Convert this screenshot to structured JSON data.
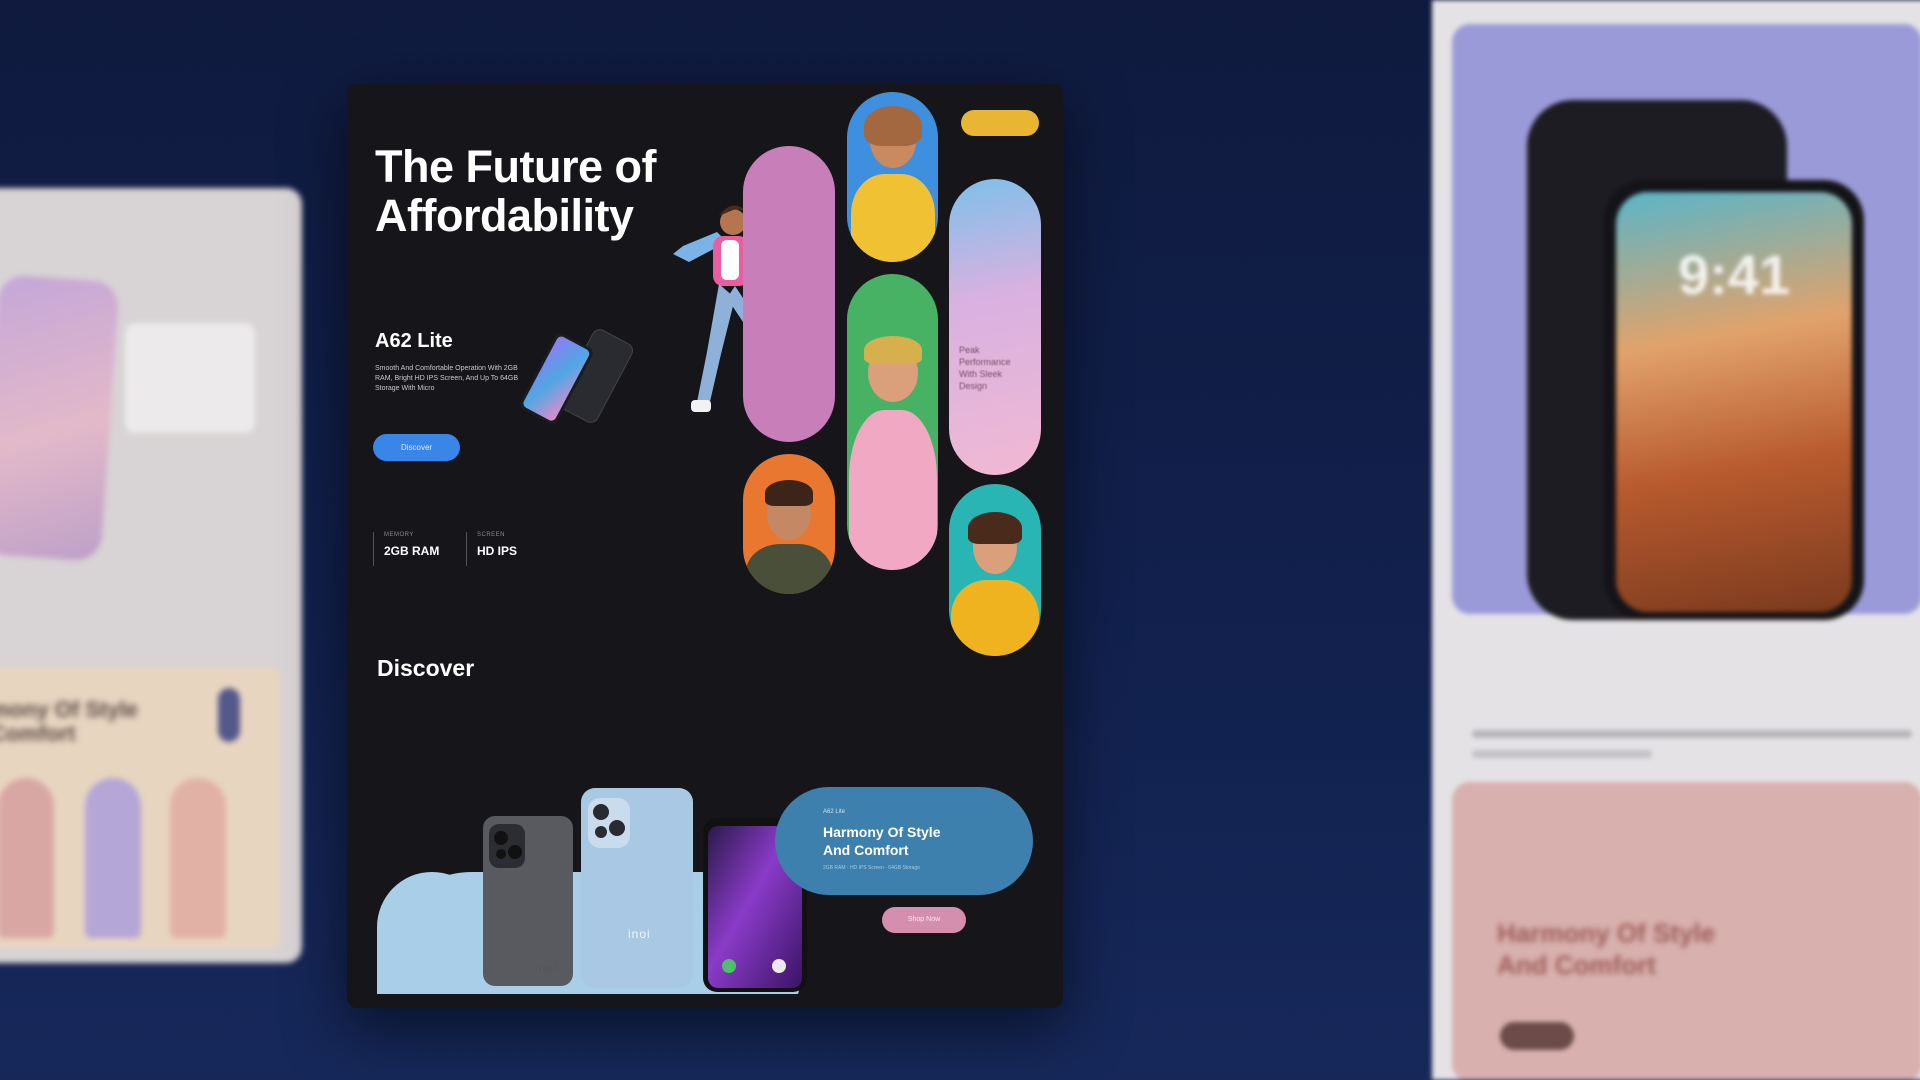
{
  "hero": {
    "title_line1": "The Future of",
    "title_line2": "Affordability"
  },
  "product": {
    "name": "A62 Lite",
    "description": "Smooth And Comfortable Operation With 2GB RAM, Bright HD IPS Screen, And Up To 64GB Storage With Micro",
    "button_label": "Discover"
  },
  "specs": [
    {
      "label": "MEMORY",
      "value": "2GB RAM"
    },
    {
      "label": "SCREEN",
      "value": "HD IPS"
    }
  ],
  "side_pill": {
    "text_line1": "Peak",
    "text_line2": "Performance",
    "text_line3": "With Sleek",
    "text_line4": "Design"
  },
  "discover": {
    "heading": "Discover",
    "phone_brand": "inoi"
  },
  "harmony": {
    "tag": "A62 Lite",
    "title_line1": "Harmony Of Style",
    "title_line2": "And Comfort",
    "sub": "2GB RAM · HD IPS Screen · 64GB Storage",
    "button_label": "Shop Now"
  },
  "left_mock": {
    "heading_line1": "mony Of Style",
    "heading_line2": "Comfort"
  },
  "right_mock": {
    "clock": "9:41",
    "heading_line1": "Harmony Of Style",
    "heading_line2": "And Comfort"
  },
  "colors": {
    "background": "#11204c",
    "card": "#161519",
    "accent_blue": "#3a86e8",
    "accent_pink": "#d58fae",
    "accent_yellow": "#e8b632"
  }
}
